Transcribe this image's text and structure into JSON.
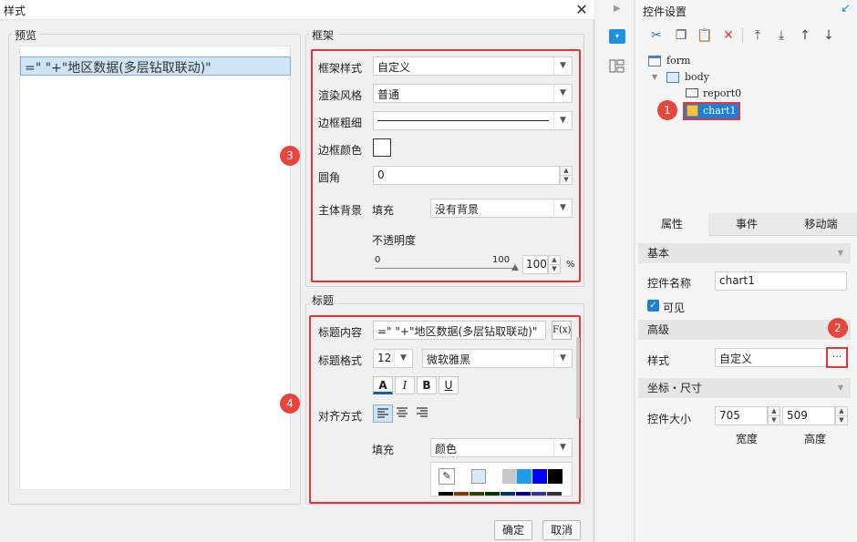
{
  "dialog": {
    "title": "样式",
    "close_glyph": "✕",
    "preview": {
      "group_title": "预览",
      "chip_text": "=\"  \"+\"地区数据(多层钻取联动)\""
    },
    "frame": {
      "group_title": "框架",
      "frame_style_label": "框架样式",
      "frame_style_value": "自定义",
      "render_style_label": "渲染风格",
      "render_style_value": "普通",
      "border_width_label": "边框粗细",
      "border_color_label": "边框颜色",
      "radius_label": "圆角",
      "radius_value": "0",
      "bg_label": "主体背景",
      "fill_label": "填充",
      "fill_value": "没有背景",
      "opacity_label": "不透明度",
      "opacity_min": "0",
      "opacity_max": "100",
      "opacity_value": "100",
      "opacity_unit": "%"
    },
    "title_group": {
      "group_title": "标题",
      "content_label": "标题内容",
      "content_value": "=\"  \"+\"地区数据(多层钻取联动)\"",
      "formula_button": "F(x)",
      "format_label": "标题格式",
      "font_size_value": "12",
      "font_family_value": "微软雅黑",
      "btn_a": "A",
      "btn_italic": "I",
      "btn_bold": "B",
      "btn_underline": "U",
      "align_label": "对齐方式",
      "fill_label": "填充",
      "fill_value": "颜色",
      "palette_colors": [
        "#d6ebf7",
        "#ffffff",
        "#c8c8c8",
        "#1e9ee8",
        "#0000ff",
        "#000000"
      ],
      "palette_row2": [
        "#000000",
        "#7a3b00",
        "#314200",
        "#003300",
        "#003366",
        "#000080",
        "#333399",
        "#333333"
      ]
    },
    "ok_button": "确定",
    "cancel_button": "取消"
  },
  "badges": [
    "1",
    "2",
    "3",
    "4"
  ],
  "right_panel": {
    "title": "控件设置",
    "tree": {
      "form": "form",
      "body": "body",
      "report": "report0",
      "chart": "chart1"
    },
    "tabs": [
      "属性",
      "事件",
      "移动端"
    ],
    "basic_section": "基本",
    "widget_name_label": "控件名称",
    "widget_name_value": "chart1",
    "visible_label": "可见",
    "advanced_section": "高级",
    "style_label": "样式",
    "style_value": "自定义",
    "style_btn": "···",
    "coord_section": "坐标・尺寸",
    "size_label": "控件大小",
    "width_value": "705",
    "height_value": "509",
    "width_label": "宽度",
    "height_label": "高度"
  },
  "colors": {
    "accent_red": "#e2383c",
    "selection_blue": "#cfe4f5",
    "checkbox_blue": "#1e7fd8"
  }
}
